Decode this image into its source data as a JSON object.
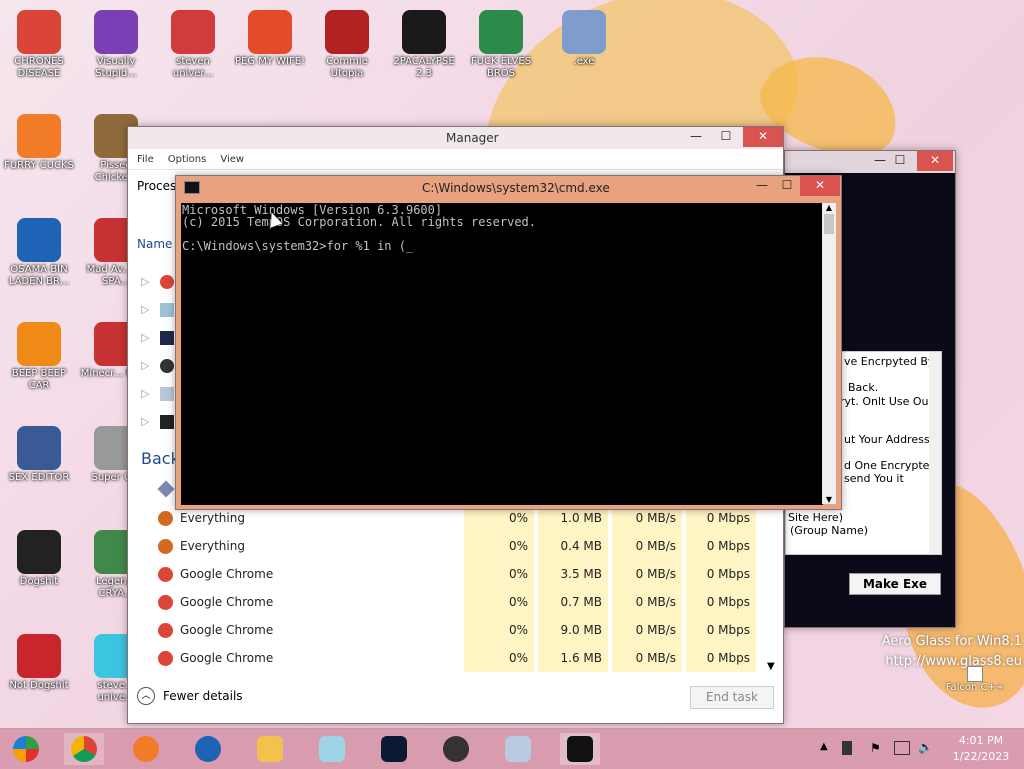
{
  "desktop": {
    "icons": [
      {
        "label": "CHRONES DISEASE",
        "color": "#db4437"
      },
      {
        "label": "Visually Stupid...",
        "color": "#7b3fb5"
      },
      {
        "label": "steven univer...",
        "color": "#d23b3b"
      },
      {
        "label": "PEG MY WIFE!",
        "color": "#e34b2b"
      },
      {
        "label": "Commie Utopia",
        "color": "#b22222"
      },
      {
        "label": "2PACALYPSE 2.3",
        "color": "#1a1a1a"
      },
      {
        "label": "FUCK ELVES BROS",
        "color": "#2c8a4a"
      },
      {
        "label": ".exe",
        "color": "#7f9ccf"
      },
      {
        "label": "FURRY CUCKS",
        "color": "#f27b2a"
      },
      {
        "label": "Pissed Chicke...",
        "color": "#8f6a3a"
      },
      {
        "label": "OSAMA BIN LADEN BR...",
        "color": "#1e63b5"
      },
      {
        "label": "Mad Av... IN SPA...",
        "color": "#c83232"
      },
      {
        "label": "BEEP BEEP CAR",
        "color": "#f08a16"
      },
      {
        "label": "Minecr... Birds",
        "color": "#c83232"
      },
      {
        "label": "SEX EDITOR",
        "color": "#3a5a96"
      },
      {
        "label": "Super C...",
        "color": "#999"
      },
      {
        "label": "Dogshit",
        "color": "#222"
      },
      {
        "label": "Legen... CRYA...",
        "color": "#3f8a4a"
      },
      {
        "label": "Not Dogshit",
        "color": "#c8262c"
      },
      {
        "label": "steve... unive...",
        "color": "#3cc5e0"
      }
    ],
    "watermark": {
      "line1": "Aero Glass for Win8.1",
      "line2": "http://www.glass8.eu"
    },
    "falcon_label": "Falcon C++"
  },
  "task_manager": {
    "title": "Manager",
    "menu": [
      "File",
      "Options",
      "View"
    ],
    "tab_label": "Process",
    "col_name": "Name",
    "back_label": "Back",
    "rows": [
      {
        "name": "Everything",
        "cpu": "0%",
        "mem": "1.0 MB",
        "disk": "0 MB/s",
        "net": "0 Mbps",
        "icon": "#d2691e"
      },
      {
        "name": "Everything",
        "cpu": "0%",
        "mem": "0.4 MB",
        "disk": "0 MB/s",
        "net": "0 Mbps",
        "icon": "#d2691e"
      },
      {
        "name": "Google Chrome",
        "cpu": "0%",
        "mem": "3.5 MB",
        "disk": "0 MB/s",
        "net": "0 Mbps",
        "icon": "#db4437"
      },
      {
        "name": "Google Chrome",
        "cpu": "0%",
        "mem": "0.7 MB",
        "disk": "0 MB/s",
        "net": "0 Mbps",
        "icon": "#db4437"
      },
      {
        "name": "Google Chrome",
        "cpu": "0%",
        "mem": "9.0 MB",
        "disk": "0 MB/s",
        "net": "0 Mbps",
        "icon": "#db4437"
      },
      {
        "name": "Google Chrome",
        "cpu": "0%",
        "mem": "1.6 MB",
        "disk": "0 MB/s",
        "net": "0 Mbps",
        "icon": "#db4437"
      }
    ],
    "fewer_details": "Fewer details",
    "end_task": "End task"
  },
  "cmd": {
    "title": "C:\\Windows\\system32\\cmd.exe",
    "line1": "Microsoft Windows [Version 6.3.9600]",
    "line2": "(c) 2015 TempOS Corporation. All rights reserved.",
    "line3": "C:\\Windows\\system32>for %1 in (_"
  },
  "right_window": {
    "text_lines": [
      "ve Encrpyted By",
      "Back.",
      "ryt. Onlt Use Our",
      "ut Your Address",
      "d One Encrypted",
      "send You it",
      "Site Here)",
      "(Group Name)"
    ],
    "make_exe": "Make Exe"
  },
  "taskbar": {
    "time": "4:01 PM",
    "date": "1/22/2023"
  }
}
